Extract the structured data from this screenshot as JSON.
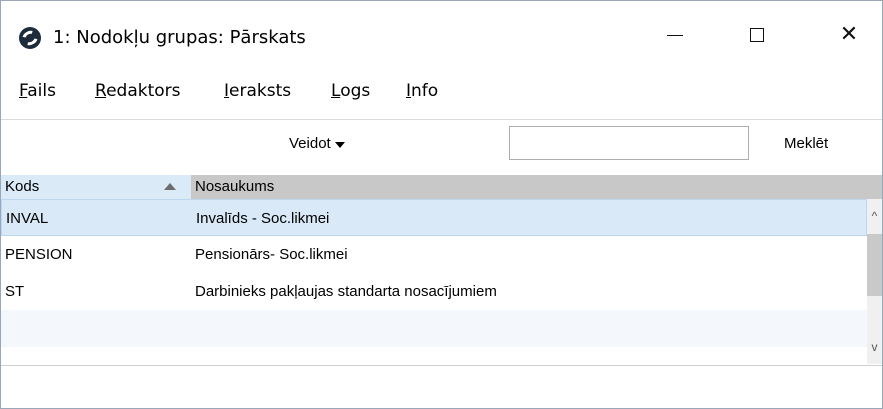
{
  "window": {
    "title": "1: Nodokļu grupas: Pārskats",
    "icon": "app-logo-icon",
    "controls": {
      "minimize": "—",
      "maximize": "☐",
      "close": "✕"
    }
  },
  "menu": {
    "items": [
      {
        "mnemonic": "F",
        "rest": "ails"
      },
      {
        "mnemonic": "R",
        "rest": "edaktors"
      },
      {
        "mnemonic": "I",
        "rest": "eraksts"
      },
      {
        "mnemonic": "L",
        "rest": "ogs"
      },
      {
        "mnemonic": "I",
        "rest": "nfo"
      }
    ]
  },
  "toolbar": {
    "create_label": "Veidot",
    "search_value": "",
    "search_button_label": "Meklēt"
  },
  "table": {
    "columns": [
      "Kods",
      "Nosaukums"
    ],
    "sort_column": "Kods",
    "sort_direction": "ascending",
    "rows": [
      {
        "kods": "INVAL",
        "nosaukums": "Invalīds - Soc.likmei",
        "selected": true
      },
      {
        "kods": "PENSION",
        "nosaukums": "Pensionārs- Soc.likmei",
        "selected": false
      },
      {
        "kods": "ST",
        "nosaukums": "Darbinieks pakļaujas standarta nosacījumiem",
        "selected": false
      }
    ]
  },
  "colors": {
    "selected_row": "#d9e9f8",
    "header_key": "#dbeaf7",
    "header": "#c8c8c8"
  }
}
